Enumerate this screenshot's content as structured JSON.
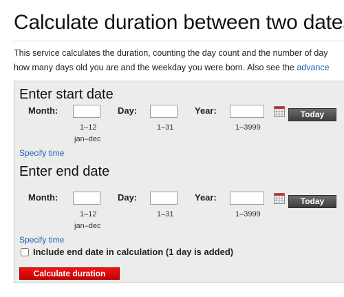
{
  "page": {
    "title": "Calculate duration between two dates",
    "intro_line1": "This service calculates the duration, counting the day count and the number of day",
    "intro_line2_text": "how many days old you are and the weekday you were born. Also see the ",
    "intro_line2_link": "advance"
  },
  "start": {
    "heading": "Enter start date",
    "month_label": "Month:",
    "day_label": "Day:",
    "year_label": "Year:",
    "month_value": "",
    "day_value": "",
    "year_value": "",
    "month_hint1": "1–12",
    "month_hint2": "jan–dec",
    "day_hint": "1–31",
    "year_hint": "1–3999",
    "today_label": "Today",
    "specify_time": "Specify time"
  },
  "end": {
    "heading": "Enter end date",
    "month_label": "Month:",
    "day_label": "Day:",
    "year_label": "Year:",
    "month_value": "",
    "day_value": "",
    "year_value": "",
    "month_hint1": "1–12",
    "month_hint2": "jan–dec",
    "day_hint": "1–31",
    "year_hint": "1–3999",
    "today_label": "Today",
    "specify_time": "Specify time"
  },
  "options": {
    "include_end_label": "Include end date in calculation (1 day is added)",
    "include_end_checked": false
  },
  "actions": {
    "calculate_label": "Calculate duration"
  },
  "icons": {
    "calendar": "calendar-icon"
  },
  "colors": {
    "link": "#1a5fb4",
    "primary_button": "#e00000",
    "panel_bg": "#ececec"
  }
}
